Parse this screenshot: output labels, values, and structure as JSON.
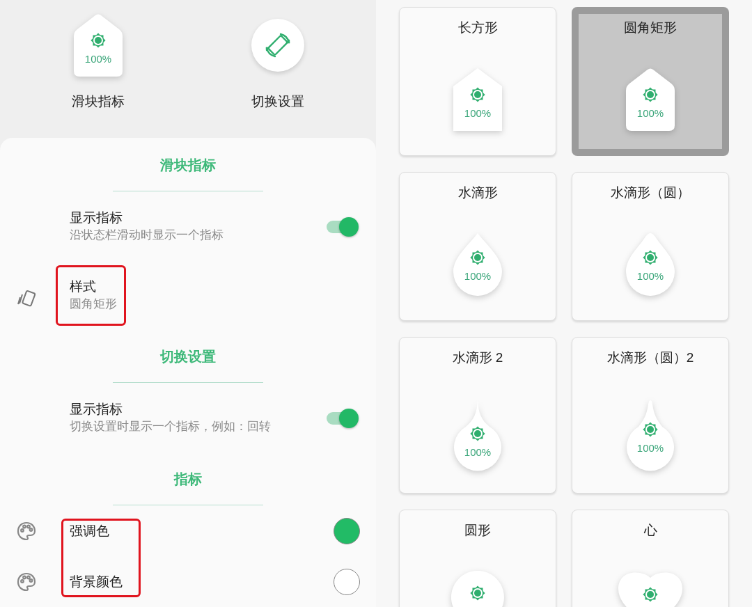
{
  "previews": [
    {
      "kind": "slider",
      "label": "滑块指标",
      "reading": "100%"
    },
    {
      "kind": "rotate",
      "label": "切换设置"
    }
  ],
  "sections": [
    {
      "title": "滑块指标",
      "items": [
        {
          "kind": "switch",
          "title": "显示指标",
          "subtitle": "沿状态栏滑动时显示一个指标",
          "on": true
        },
        {
          "kind": "option",
          "title": "样式",
          "subtitle": "圆角矩形",
          "highlighted": true
        }
      ]
    },
    {
      "title": "切换设置",
      "items": [
        {
          "kind": "switch",
          "title": "显示指标",
          "subtitle": "切换设置时显示一个指标，例如：回转",
          "on": true
        }
      ]
    },
    {
      "title": "指标",
      "highlighted": true,
      "items": [
        {
          "kind": "color",
          "title": "强调色",
          "color": "#22bb66"
        },
        {
          "kind": "color",
          "title": "背景颜色",
          "color": "#ffffff"
        }
      ]
    }
  ],
  "styles": [
    {
      "label": "长方形",
      "kind": "rectangle",
      "reading": "100%",
      "selected": false
    },
    {
      "label": "圆角矩形",
      "kind": "rounded",
      "reading": "100%",
      "selected": true
    },
    {
      "label": "水滴形",
      "kind": "drop",
      "reading": "100%",
      "selected": false
    },
    {
      "label": "水滴形（圆）",
      "kind": "drop-round",
      "reading": "100%",
      "selected": false
    },
    {
      "label": "水滴形 2",
      "kind": "drop2",
      "reading": "100%",
      "selected": false
    },
    {
      "label": "水滴形（圆）2",
      "kind": "drop-round2",
      "reading": "100%",
      "selected": false
    },
    {
      "label": "圆形",
      "kind": "circle",
      "selected": false
    },
    {
      "label": "心",
      "kind": "heart",
      "selected": false
    }
  ]
}
